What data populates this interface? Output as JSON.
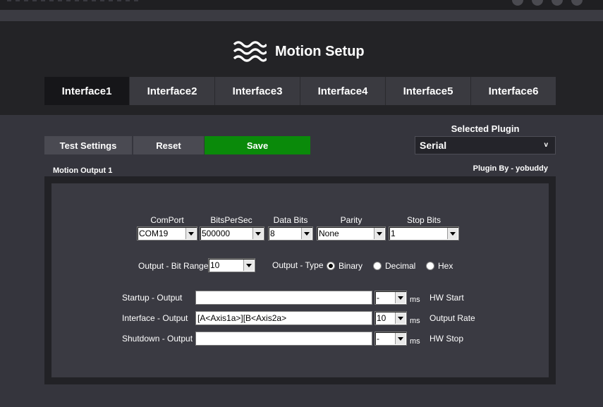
{
  "header": {
    "title": "Motion Setup"
  },
  "tabs": [
    {
      "label": "Interface1",
      "active": true
    },
    {
      "label": "Interface2",
      "active": false
    },
    {
      "label": "Interface3",
      "active": false
    },
    {
      "label": "Interface4",
      "active": false
    },
    {
      "label": "Interface5",
      "active": false
    },
    {
      "label": "Interface6",
      "active": false
    }
  ],
  "toolbar": {
    "test_label": "Test Settings",
    "reset_label": "Reset",
    "save_label": "Save"
  },
  "plugin": {
    "label": "Selected Plugin",
    "value": "Serial",
    "by": "Plugin By - yobuddy"
  },
  "section": {
    "title": "Motion Output 1"
  },
  "serial": {
    "comport": {
      "label": "ComPort",
      "value": "COM19"
    },
    "bits_per_sec": {
      "label": "BitsPerSec",
      "value": "500000"
    },
    "data_bits": {
      "label": "Data Bits",
      "value": "8"
    },
    "parity": {
      "label": "Parity",
      "value": "None"
    },
    "stop_bits": {
      "label": "Stop Bits",
      "value": "1"
    }
  },
  "output": {
    "bit_range_label": "Output - Bit Range",
    "bit_range_value": "10",
    "type_label": "Output - Type",
    "types": [
      {
        "label": "Binary",
        "selected": true
      },
      {
        "label": "Decimal",
        "selected": false
      },
      {
        "label": "Hex",
        "selected": false
      }
    ]
  },
  "rows": [
    {
      "label": "Startup - Output",
      "value": "",
      "ms_value": "-",
      "ms_unit": "ms",
      "right_label": "HW Start"
    },
    {
      "label": "Interface - Output",
      "value": "[A<Axis1a>][B<Axis2a>",
      "ms_value": "10",
      "ms_unit": "ms",
      "right_label": "Output Rate"
    },
    {
      "label": "Shutdown - Output",
      "value": "",
      "ms_value": "-",
      "ms_unit": "ms",
      "right_label": "HW Stop"
    }
  ],
  "colors": {
    "save": "#0a8a0a",
    "background": "#35353d",
    "header": "#232326"
  }
}
